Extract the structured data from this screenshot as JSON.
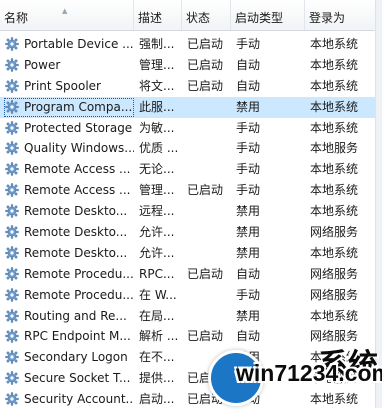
{
  "columns": {
    "name": "名称",
    "desc": "描述",
    "status": "状态",
    "startup": "启动类型",
    "logon": "登录为"
  },
  "rows": [
    {
      "name": "Portable Device ...",
      "desc": "强制...",
      "status": "已启动",
      "startup": "手动",
      "logon": "本地系统"
    },
    {
      "name": "Power",
      "desc": "管理...",
      "status": "已启动",
      "startup": "自动",
      "logon": "本地系统"
    },
    {
      "name": "Print Spooler",
      "desc": "将文...",
      "status": "已启动",
      "startup": "自动",
      "logon": "本地系统"
    },
    {
      "name": "Program Compa...",
      "desc": "此服...",
      "status": "",
      "startup": "禁用",
      "logon": "本地系统"
    },
    {
      "name": "Protected Storage",
      "desc": "为敏...",
      "status": "",
      "startup": "手动",
      "logon": "本地系统"
    },
    {
      "name": "Quality Windows...",
      "desc": "优质 ...",
      "status": "",
      "startup": "手动",
      "logon": "本地服务"
    },
    {
      "name": "Remote Access ...",
      "desc": "无论...",
      "status": "",
      "startup": "手动",
      "logon": "本地系统"
    },
    {
      "name": "Remote Access ...",
      "desc": "管理...",
      "status": "已启动",
      "startup": "手动",
      "logon": "本地系统"
    },
    {
      "name": "Remote Deskto...",
      "desc": "远程...",
      "status": "",
      "startup": "禁用",
      "logon": "本地系统"
    },
    {
      "name": "Remote Deskto...",
      "desc": "允许...",
      "status": "",
      "startup": "禁用",
      "logon": "网络服务"
    },
    {
      "name": "Remote Deskto...",
      "desc": "允许...",
      "status": "",
      "startup": "禁用",
      "logon": "本地系统"
    },
    {
      "name": "Remote Procedu...",
      "desc": "RPC...",
      "status": "已启动",
      "startup": "自动",
      "logon": "网络服务"
    },
    {
      "name": "Remote Procedu...",
      "desc": "在 W...",
      "status": "",
      "startup": "手动",
      "logon": "网络服务"
    },
    {
      "name": "Routing and Re...",
      "desc": "在局...",
      "status": "",
      "startup": "禁用",
      "logon": "本地系统"
    },
    {
      "name": "RPC Endpoint M...",
      "desc": "解析 ...",
      "status": "已启动",
      "startup": "自动",
      "logon": "网络服务"
    },
    {
      "name": "Secondary Logon",
      "desc": "在不...",
      "status": "",
      "startup": "禁用",
      "logon": "本地系统"
    },
    {
      "name": "Secure Socket T...",
      "desc": "提供...",
      "status": "已启动",
      "startup": "手动",
      "logon": "本地服务"
    },
    {
      "name": "Security Account...",
      "desc": "启动...",
      "status": "已启动",
      "startup": "自动",
      "logon": "本地系统"
    }
  ],
  "selected_index": 3,
  "icon": "gear-icon",
  "watermark": {
    "text": "win71234.com",
    "glyphs": "系统"
  },
  "colors": {
    "selection": "#cce8ff",
    "header": "#f1f3f6",
    "icon": "#5a8fc4"
  }
}
